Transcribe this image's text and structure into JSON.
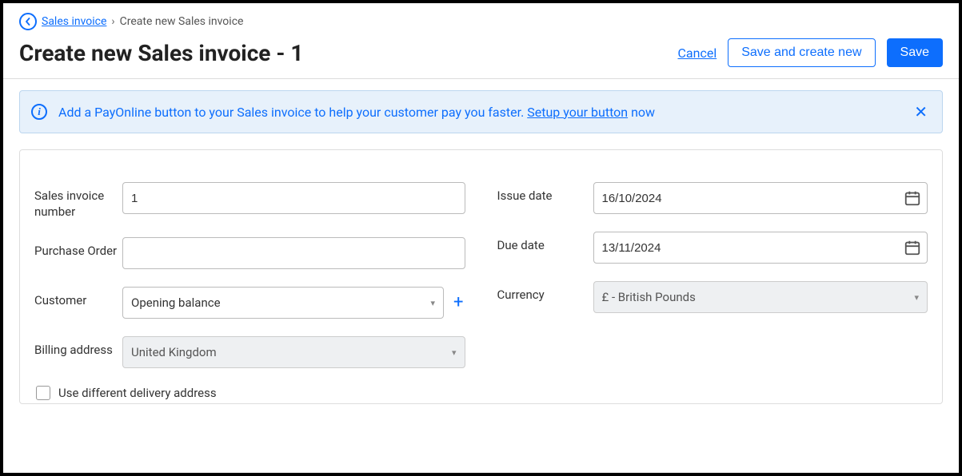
{
  "breadcrumb": {
    "parent": "Sales invoice",
    "current": "Create new Sales invoice"
  },
  "header": {
    "title": "Create new Sales invoice - 1",
    "cancel": "Cancel",
    "save_and_create": "Save and create new",
    "save": "Save"
  },
  "banner": {
    "text_pre": "Add a PayOnline button to your Sales invoice to help your customer pay you faster. ",
    "link": "Setup your button",
    "text_post": " now"
  },
  "form": {
    "invoice_number_label": "Sales invoice number",
    "invoice_number_value": "1",
    "purchase_order_label": "Purchase Order",
    "purchase_order_value": "",
    "customer_label": "Customer",
    "customer_value": "Opening balance",
    "billing_label": "Billing address",
    "billing_value": "United Kingdom",
    "issue_date_label": "Issue date",
    "issue_date_value": "16/10/2024",
    "due_date_label": "Due date",
    "due_date_value": "13/11/2024",
    "currency_label": "Currency",
    "currency_value": "£ - British Pounds",
    "delivery_checkbox_label": "Use different delivery address"
  }
}
